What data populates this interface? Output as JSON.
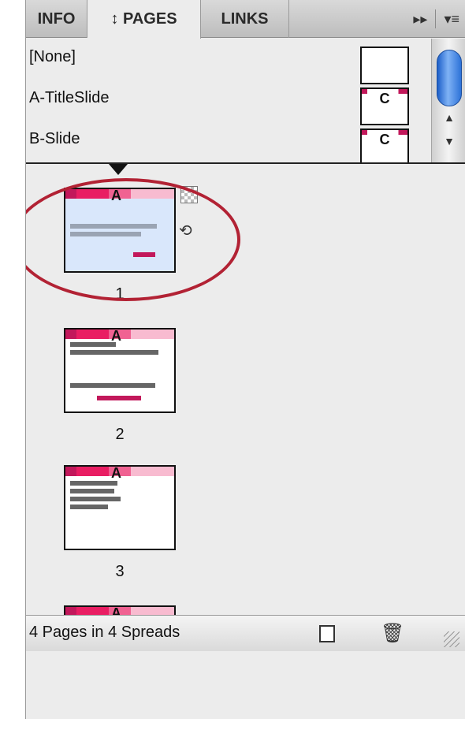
{
  "tabs": [
    {
      "label": "INFO"
    },
    {
      "label": "↕ PAGES"
    },
    {
      "label": "LINKS"
    }
  ],
  "tools": {
    "forward": "▸▸",
    "menu": "▾≡"
  },
  "masters": [
    {
      "label": "[None]",
      "thumb_letter": ""
    },
    {
      "label": "A-TitleSlide",
      "thumb_letter": "C"
    },
    {
      "label": "B-Slide",
      "thumb_letter": "C"
    }
  ],
  "pages": [
    {
      "number": "1",
      "letter": "A",
      "selected": true
    },
    {
      "number": "2",
      "letter": "A",
      "selected": false
    },
    {
      "number": "3",
      "letter": "A",
      "selected": false
    },
    {
      "number": "",
      "letter": "A",
      "selected": false
    }
  ],
  "status": "4 Pages in 4 Spreads",
  "icons": {
    "new_page": "new-page-icon",
    "trash": "trash-icon"
  },
  "colors": {
    "accent": "#c2185b",
    "circle": "#b22234",
    "scroll": "#2d72d8"
  }
}
